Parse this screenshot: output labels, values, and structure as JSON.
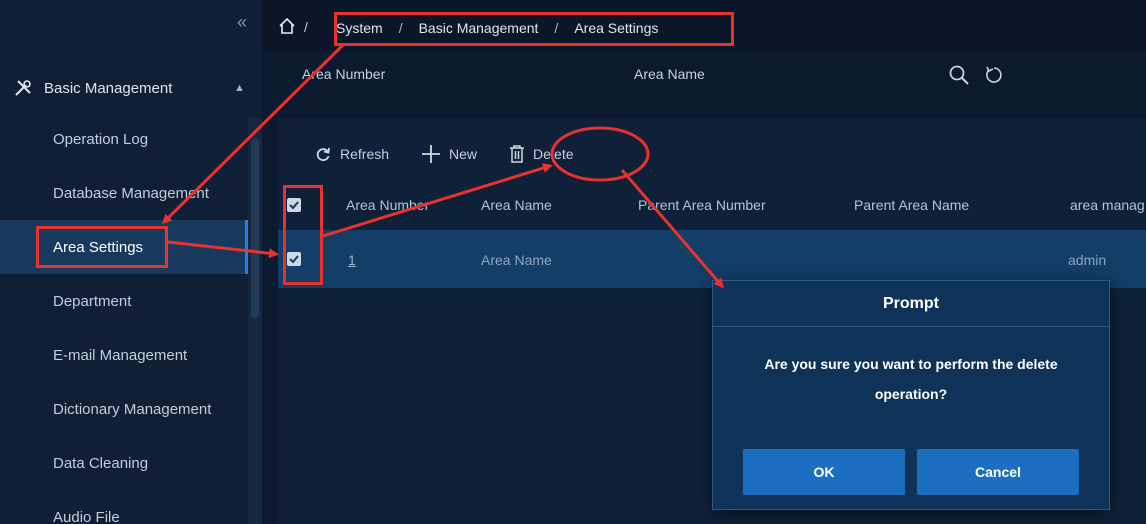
{
  "sidebar": {
    "collapse_icon": "double-chevron-left-icon",
    "group": {
      "label": "Basic Management",
      "icon": "tools-icon",
      "chevron": "chevron-up-icon"
    },
    "items": [
      {
        "label": "Operation Log"
      },
      {
        "label": "Database Management"
      },
      {
        "label": "Area Settings",
        "active": true
      },
      {
        "label": "Department"
      },
      {
        "label": "E-mail Management"
      },
      {
        "label": "Dictionary Management"
      },
      {
        "label": "Data Cleaning"
      },
      {
        "label": "Audio File"
      }
    ]
  },
  "breadcrumb": {
    "home_icon": "home-icon",
    "separator": "/",
    "items": [
      "System",
      "Basic Management",
      "Area Settings"
    ]
  },
  "search": {
    "area_number_label": "Area Number",
    "area_name_label": "Area Name",
    "search_icon": "search-icon",
    "reset_icon": "reset-icon"
  },
  "toolbar": {
    "refresh_label": "Refresh",
    "new_label": "New",
    "delete_label": "Delete"
  },
  "table": {
    "columns": [
      "Area Number",
      "Area Name",
      "Parent Area Number",
      "Parent Area Name",
      "area manag"
    ],
    "rows": [
      {
        "area_number": "1",
        "area_name": "Area Name",
        "parent_area_number": "",
        "parent_area_name": "",
        "area_manager": "admin",
        "checked": true
      }
    ],
    "header_checked": true
  },
  "modal": {
    "title": "Prompt",
    "message": "Are you sure you want to perform the delete operation?",
    "ok_label": "OK",
    "cancel_label": "Cancel"
  },
  "colors": {
    "annotation": "#e8322f",
    "accent": "#1c6fc0",
    "background": "#0b1a2e"
  }
}
